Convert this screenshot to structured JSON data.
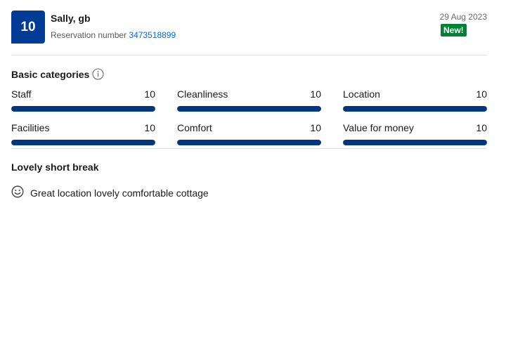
{
  "review": {
    "score": "10",
    "reviewer": "Sally, gb",
    "reservation_label": "Reservation number",
    "reservation_number": "3473518899",
    "date": "29 Aug 2023",
    "badge": "New!",
    "title": "Lovely short break",
    "positive_text": "Great location lovely comfortable cottage",
    "positive_icon": "smiley-face-icon"
  },
  "categories_section": {
    "title": "Basic categories",
    "info_icon": "info-icon",
    "items": [
      {
        "label": "Staff",
        "score": "10",
        "fraction": 1.0
      },
      {
        "label": "Cleanliness",
        "score": "10",
        "fraction": 1.0
      },
      {
        "label": "Location",
        "score": "10",
        "fraction": 1.0
      },
      {
        "label": "Facilities",
        "score": "10",
        "fraction": 1.0
      },
      {
        "label": "Comfort",
        "score": "10",
        "fraction": 1.0
      },
      {
        "label": "Value for money",
        "score": "10",
        "fraction": 1.0
      }
    ]
  },
  "colors": {
    "score_box": "#003b95",
    "bar_fill": "#003580",
    "badge": "#008234",
    "link": "#006ce4"
  }
}
